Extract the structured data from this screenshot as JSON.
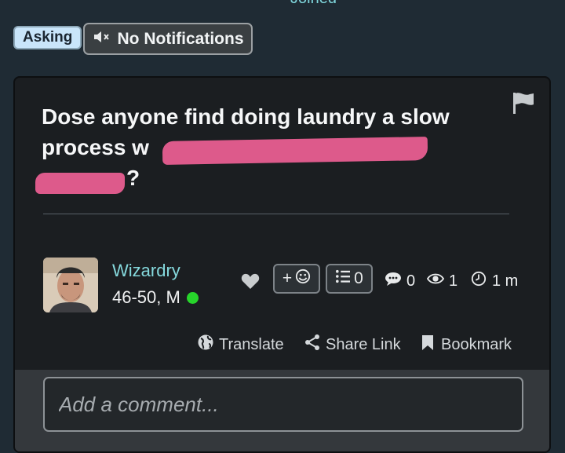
{
  "header": {
    "top_label": "Joined"
  },
  "tags": {
    "category": "Asking"
  },
  "notifications": {
    "label": "No Notifications",
    "icon": "muted-speaker-icon"
  },
  "post": {
    "question_start": "Dose anyone find doing laundry a slow process w",
    "question_end": "?",
    "author": {
      "name": "Wizardry",
      "age_range": "46-50, M",
      "online_color": "#27d52b"
    },
    "reactions": {
      "add_label": "+",
      "list_count": "0"
    },
    "stats": {
      "comments": "0",
      "views": "1",
      "age": "1 m"
    },
    "actions": {
      "translate": "Translate",
      "share": "Share Link",
      "bookmark": "Bookmark"
    }
  },
  "comment": {
    "placeholder": "Add a comment..."
  },
  "colors": {
    "accent": "#85d9dd",
    "badge_bg": "#c9e5fa",
    "redaction": "#ee5f95"
  }
}
